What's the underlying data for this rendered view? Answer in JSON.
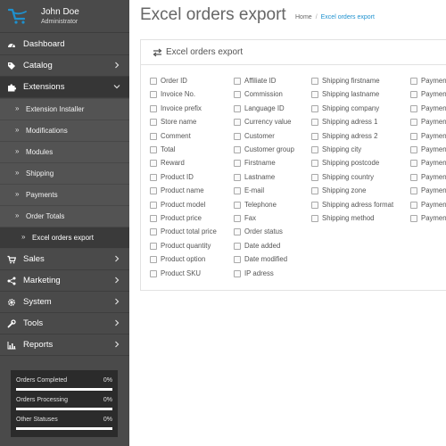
{
  "user": {
    "name": "John Doe",
    "role": "Administrator"
  },
  "menu": [
    {
      "label": "Dashboard",
      "icon": "dashboard-icon",
      "has_children": false
    },
    {
      "label": "Catalog",
      "icon": "tag-icon",
      "has_children": true
    },
    {
      "label": "Extensions",
      "icon": "puzzle-icon",
      "has_children": true,
      "expanded": true
    },
    {
      "label": "Sales",
      "icon": "cart-icon",
      "has_children": true
    },
    {
      "label": "Marketing",
      "icon": "share-icon",
      "has_children": true
    },
    {
      "label": "System",
      "icon": "gear-icon",
      "has_children": true
    },
    {
      "label": "Tools",
      "icon": "wrench-icon",
      "has_children": true
    },
    {
      "label": "Reports",
      "icon": "bar-chart-icon",
      "has_children": true
    }
  ],
  "submenu": [
    "Extension Installer",
    "Modifications",
    "Modules",
    "Shipping",
    "Payments",
    "Order Totals",
    "Excel orders export"
  ],
  "stats": [
    {
      "label": "Orders Completed",
      "percent_text": "0%",
      "fraction": 0
    },
    {
      "label": "Orders Processing",
      "percent_text": "0%",
      "fraction": 0
    },
    {
      "label": "Other Statuses",
      "percent_text": "0%",
      "fraction": 0
    }
  ],
  "page": {
    "title": "Excel orders export",
    "breadcrumb_home": "Home",
    "breadcrumb_sep": "/",
    "breadcrumb_current": "Excel orders export"
  },
  "panel": {
    "title": "Excel orders export"
  },
  "columns": [
    [
      "Order ID",
      "Invoice No.",
      "Invoice prefix",
      "Store name",
      "Comment",
      "Total",
      "Reward",
      "Product ID",
      "Product name",
      "Product model",
      "Product price",
      "Product total price",
      "Product quantity",
      "Product option",
      "Product SKU"
    ],
    [
      "Affiliate ID",
      "Commission",
      "Language ID",
      "Currency value",
      "Customer",
      "Customer group",
      "Firstname",
      "Lastname",
      "E-mail",
      "Telephone",
      "Fax",
      "Order status",
      "Date added",
      "Date modified",
      "IP adress"
    ],
    [
      "Shipping firstname",
      "Shipping lastname",
      "Shipping company",
      "Shipping adress 1",
      "Shipping adress 2",
      "Shipping city",
      "Shipping postcode",
      "Shipping country",
      "Shipping zone",
      "Shipping adress format",
      "Shipping method"
    ],
    [
      "Paymen",
      "Paymen",
      "Paymen",
      "Paymen",
      "Paymen",
      "Paymen",
      "Paymen",
      "Paymen",
      "Paymen",
      "Paymen",
      "Paymen"
    ]
  ],
  "colors": {
    "sidebar": "#4a4a4a",
    "accent": "#1e91cf",
    "logo": "#1e91cf"
  }
}
